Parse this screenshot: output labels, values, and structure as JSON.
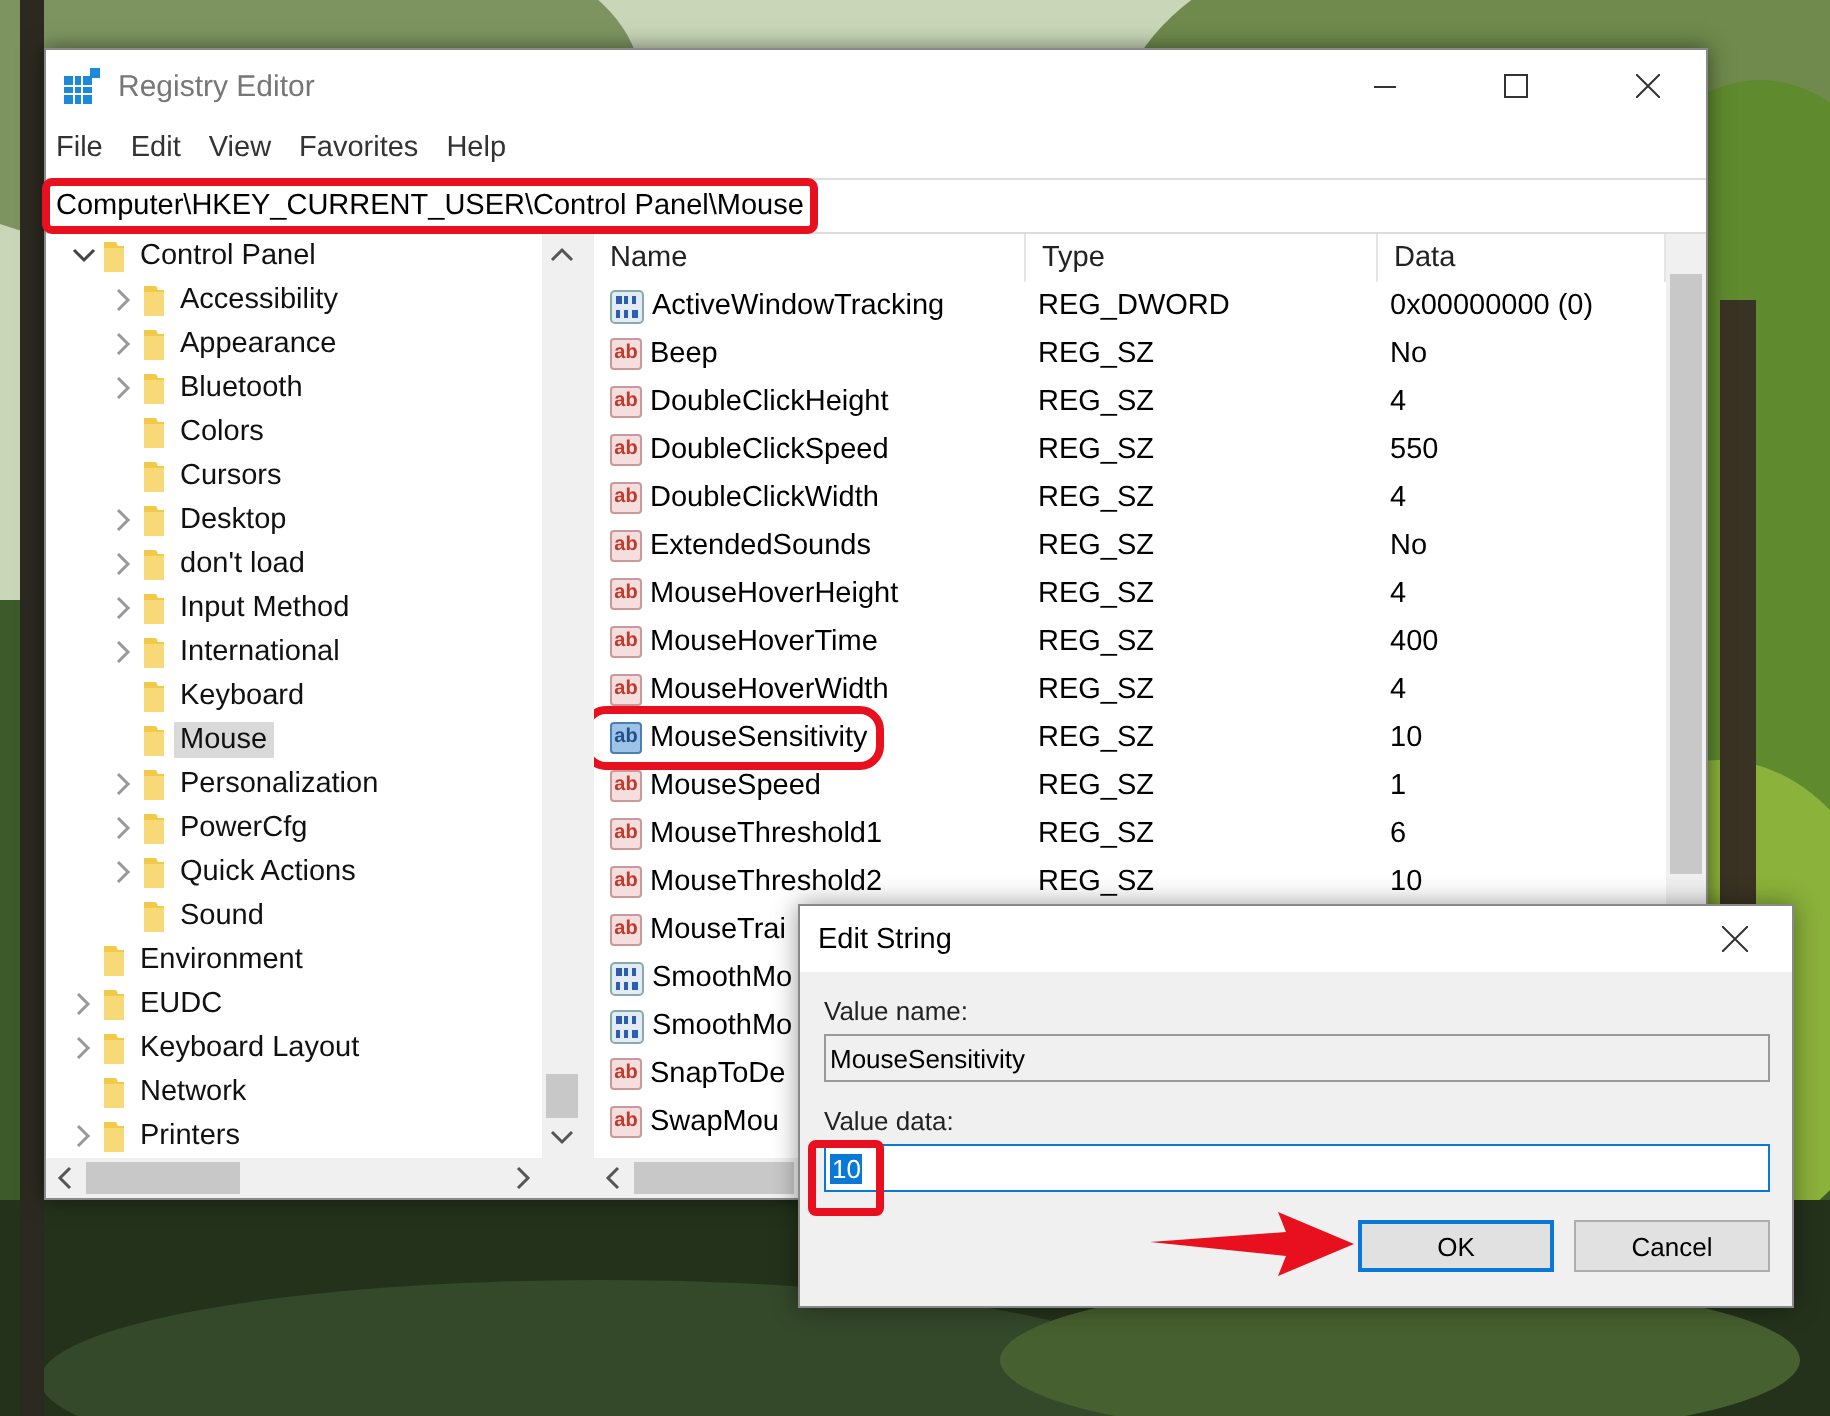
{
  "window": {
    "title": "Registry Editor"
  },
  "menu": [
    "File",
    "Edit",
    "View",
    "Favorites",
    "Help"
  ],
  "address": {
    "value": "Computer\\HKEY_CURRENT_USER\\Control Panel\\Mouse",
    "highlighted": true
  },
  "tree": [
    {
      "label": "Control Panel",
      "expandable": true,
      "expanded": true,
      "selected": false,
      "children": [
        {
          "label": "Accessibility",
          "expandable": true,
          "expanded": false,
          "selected": false
        },
        {
          "label": "Appearance",
          "expandable": true,
          "expanded": false,
          "selected": false
        },
        {
          "label": "Bluetooth",
          "expandable": true,
          "expanded": false,
          "selected": false
        },
        {
          "label": "Colors",
          "expandable": false,
          "expanded": false,
          "selected": false
        },
        {
          "label": "Cursors",
          "expandable": false,
          "expanded": false,
          "selected": false
        },
        {
          "label": "Desktop",
          "expandable": true,
          "expanded": false,
          "selected": false
        },
        {
          "label": "don't load",
          "expandable": true,
          "expanded": false,
          "selected": false
        },
        {
          "label": "Input Method",
          "expandable": true,
          "expanded": false,
          "selected": false
        },
        {
          "label": "International",
          "expandable": true,
          "expanded": false,
          "selected": false
        },
        {
          "label": "Keyboard",
          "expandable": false,
          "expanded": false,
          "selected": false
        },
        {
          "label": "Mouse",
          "expandable": false,
          "expanded": false,
          "selected": true
        },
        {
          "label": "Personalization",
          "expandable": true,
          "expanded": false,
          "selected": false
        },
        {
          "label": "PowerCfg",
          "expandable": true,
          "expanded": false,
          "selected": false
        },
        {
          "label": "Quick Actions",
          "expandable": true,
          "expanded": false,
          "selected": false
        },
        {
          "label": "Sound",
          "expandable": false,
          "expanded": false,
          "selected": false
        }
      ]
    },
    {
      "label": "Environment",
      "expandable": false,
      "expanded": false,
      "selected": false
    },
    {
      "label": "EUDC",
      "expandable": true,
      "expanded": false,
      "selected": false
    },
    {
      "label": "Keyboard Layout",
      "expandable": true,
      "expanded": false,
      "selected": false
    },
    {
      "label": "Network",
      "expandable": false,
      "expanded": false,
      "selected": false
    },
    {
      "label": "Printers",
      "expandable": true,
      "expanded": false,
      "selected": false
    }
  ],
  "columns": [
    "Name",
    "Type",
    "Data"
  ],
  "rows": [
    {
      "kind": "binary",
      "name": "ActiveWindowTracking",
      "type": "REG_DWORD",
      "data": "0x00000000 (0)",
      "selected": false,
      "highlighted": false
    },
    {
      "kind": "string",
      "icon": "ab",
      "name": "Beep",
      "type": "REG_SZ",
      "data": "No",
      "selected": false,
      "highlighted": false
    },
    {
      "kind": "string",
      "icon": "ab",
      "name": "DoubleClickHeight",
      "type": "REG_SZ",
      "data": "4",
      "selected": false,
      "highlighted": false
    },
    {
      "kind": "string",
      "icon": "ab",
      "name": "DoubleClickSpeed",
      "type": "REG_SZ",
      "data": "550",
      "selected": false,
      "highlighted": false
    },
    {
      "kind": "string",
      "icon": "ab",
      "name": "DoubleClickWidth",
      "type": "REG_SZ",
      "data": "4",
      "selected": false,
      "highlighted": false
    },
    {
      "kind": "string",
      "icon": "ab",
      "name": "ExtendedSounds",
      "type": "REG_SZ",
      "data": "No",
      "selected": false,
      "highlighted": false
    },
    {
      "kind": "string",
      "icon": "ab",
      "name": "MouseHoverHeight",
      "type": "REG_SZ",
      "data": "4",
      "selected": false,
      "highlighted": false
    },
    {
      "kind": "string",
      "icon": "ab",
      "name": "MouseHoverTime",
      "type": "REG_SZ",
      "data": "400",
      "selected": false,
      "highlighted": false
    },
    {
      "kind": "string",
      "icon": "ab",
      "name": "MouseHoverWidth",
      "type": "REG_SZ",
      "data": "4",
      "selected": false,
      "highlighted": false
    },
    {
      "kind": "string",
      "icon": "ab",
      "name": "MouseSensitivity",
      "type": "REG_SZ",
      "data": "10",
      "selected": true,
      "highlighted": true
    },
    {
      "kind": "string",
      "icon": "ab",
      "name": "MouseSpeed",
      "type": "REG_SZ",
      "data": "1",
      "selected": false,
      "highlighted": false
    },
    {
      "kind": "string",
      "icon": "ab",
      "name": "MouseThreshold1",
      "type": "REG_SZ",
      "data": "6",
      "selected": false,
      "highlighted": false
    },
    {
      "kind": "string",
      "icon": "ab",
      "name": "MouseThreshold2",
      "type": "REG_SZ",
      "data": "10",
      "selected": false,
      "highlighted": false
    },
    {
      "kind": "string",
      "icon": "ab",
      "name": "MouseTrai",
      "selected": false,
      "highlighted": false
    },
    {
      "kind": "binary",
      "name": "SmoothMo",
      "selected": false,
      "highlighted": false
    },
    {
      "kind": "binary",
      "name": "SmoothMo",
      "selected": false,
      "highlighted": false
    },
    {
      "kind": "string",
      "icon": "ab",
      "name": "SnapToDe",
      "selected": false,
      "highlighted": false
    },
    {
      "kind": "string",
      "icon": "ab",
      "name": "SwapMou",
      "selected": false,
      "highlighted": false
    }
  ],
  "dialog": {
    "title": "Edit String",
    "name_label": "Value name:",
    "name_value": "MouseSensitivity",
    "data_label": "Value data:",
    "data_value": "10",
    "data_highlighted": true,
    "buttons": [
      "OK",
      "Cancel"
    ]
  }
}
